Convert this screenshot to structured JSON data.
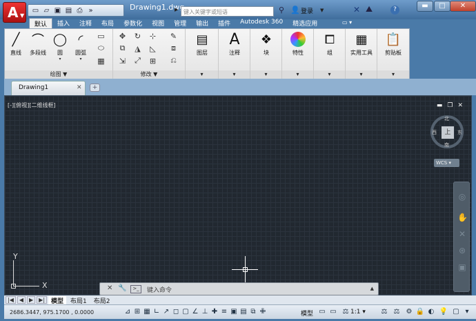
{
  "window": {
    "title": "Drawing1.dwg",
    "search_placeholder": "键入关键字或短语",
    "login": "登录",
    "controls": {
      "minimize": "▬",
      "maximize": "□",
      "close": "✕"
    }
  },
  "qat_icons": [
    "new-icon",
    "open-icon",
    "save-icon",
    "save-as-icon",
    "print-icon",
    "more-icon"
  ],
  "tabs": [
    {
      "label": "默认",
      "active": true
    },
    {
      "label": "插入"
    },
    {
      "label": "注释"
    },
    {
      "label": "布局"
    },
    {
      "label": "参数化"
    },
    {
      "label": "视图"
    },
    {
      "label": "管理"
    },
    {
      "label": "输出"
    },
    {
      "label": "插件"
    },
    {
      "label": "Autodesk 360"
    },
    {
      "label": "精选应用"
    }
  ],
  "ribbon": {
    "draw": {
      "title": "绘图 ▼",
      "line": "直线",
      "polyline": "多段线",
      "circle": "圆",
      "arc": "圆弧"
    },
    "modify": {
      "title": "修改 ▼"
    },
    "layers": "图层",
    "annotation": "注释",
    "block": "块",
    "properties": "特性",
    "groups": "组",
    "utilities": "实用工具",
    "clipboard": "剪贴板"
  },
  "file_tab": {
    "label": "Drawing1",
    "close": "✕"
  },
  "viewport": {
    "label": "[-][俯视][二维线框]",
    "viewcube": {
      "face": "上",
      "north": "北",
      "south": "南",
      "east": "东",
      "west": "西"
    },
    "wcs": "WCS ▾",
    "ucs": {
      "x": "X",
      "y": "Y"
    }
  },
  "command": {
    "placeholder": "键入命令"
  },
  "layout_tabs": [
    {
      "label": "模型",
      "active": true
    },
    {
      "label": "布局1"
    },
    {
      "label": "布局2"
    }
  ],
  "status": {
    "coords": "2686.3447, 975.1700 , 0.0000",
    "model": "模型",
    "scale": "1:1 ▾"
  },
  "colors": {
    "canvas_bg": "#212830",
    "title_bar": "#4f7fb0",
    "app_button": "#c8231e"
  }
}
